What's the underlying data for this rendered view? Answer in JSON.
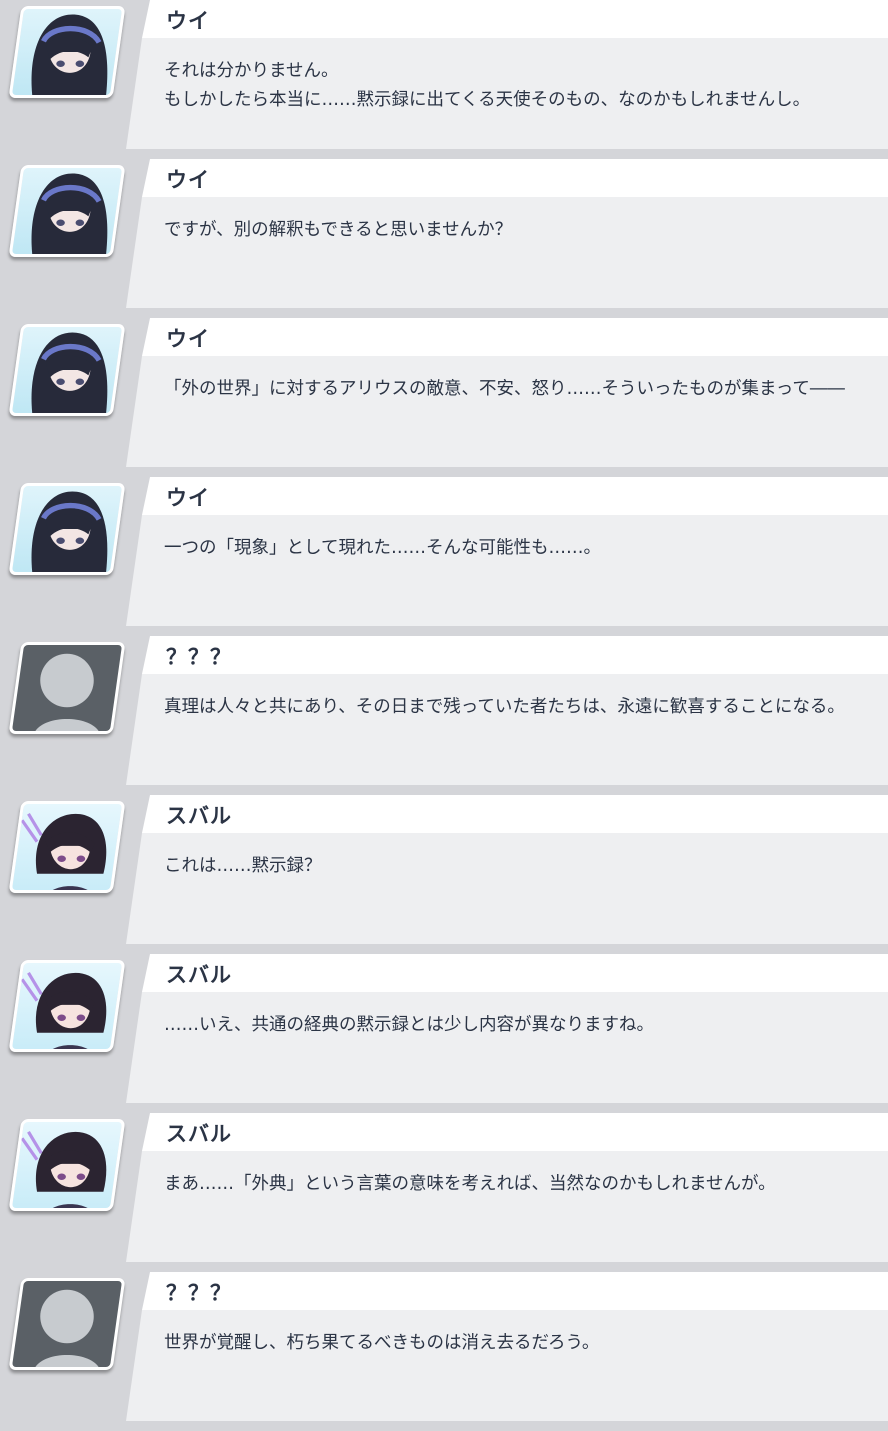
{
  "entries": [
    {
      "speaker": "ウイ",
      "avatar": "ui",
      "lines": [
        "それは分かりません。",
        "もしかしたら本当に……黙示録に出てくる天使そのもの、なのかもしれませんし。"
      ]
    },
    {
      "speaker": "ウイ",
      "avatar": "ui",
      "lines": [
        "ですが、別の解釈もできると思いませんか？"
      ]
    },
    {
      "speaker": "ウイ",
      "avatar": "ui",
      "lines": [
        "「外の世界」に対するアリウスの敵意、不安、怒り……そういったものが集まって――"
      ]
    },
    {
      "speaker": "ウイ",
      "avatar": "ui",
      "lines": [
        "一つの「現象」として現れた……そんな可能性も……。"
      ]
    },
    {
      "speaker": "？？？",
      "avatar": "unknown",
      "lines": [
        "真理は人々と共にあり、その日まで残っていた者たちは、永遠に歓喜することになる。"
      ]
    },
    {
      "speaker": "スバル",
      "avatar": "subaru",
      "lines": [
        "これは……黙示録？"
      ]
    },
    {
      "speaker": "スバル",
      "avatar": "subaru",
      "lines": [
        "……いえ、共通の経典の黙示録とは少し内容が異なりますね。"
      ]
    },
    {
      "speaker": "スバル",
      "avatar": "subaru",
      "lines": [
        "まあ……「外典」という言葉の意味を考えれば、当然なのかもしれませんが。"
      ]
    },
    {
      "speaker": "？？？",
      "avatar": "unknown",
      "lines": [
        "世界が覚醒し、朽ち果てるべきものは消え去るだろう。"
      ]
    }
  ],
  "avatars": {
    "ui": {
      "icon": "ui-portrait-icon",
      "hair": "#272a3a",
      "band": "#6a78c9",
      "skin": "#f3e6e4"
    },
    "subaru": {
      "icon": "subaru-portrait-icon",
      "hair": "#2b2431",
      "accent": "#b592e8",
      "skin": "#f6e3df"
    },
    "unknown": {
      "icon": "unknown-silhouette-icon",
      "fill": "#c7cbcf"
    }
  },
  "colors": {
    "page_background": "#d4d5d9",
    "name_header": "#ffffff",
    "message_body": "#eeeff1",
    "text": "#2b3445"
  }
}
